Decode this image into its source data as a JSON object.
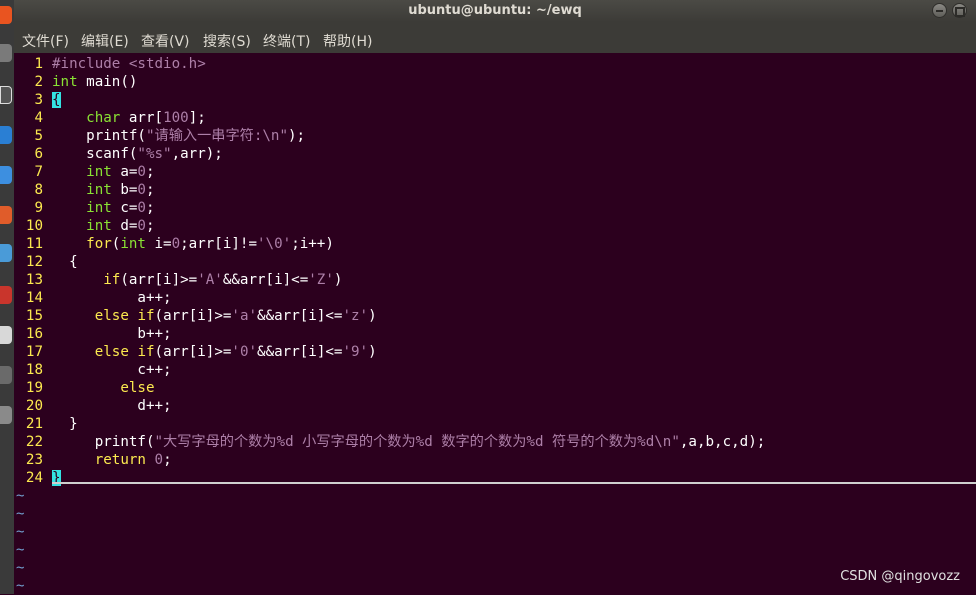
{
  "window": {
    "title": "ubuntu@ubuntu: ~/ewq"
  },
  "menubar": [
    "文件(F)",
    "编辑(E)",
    "查看(V)",
    "搜索(S)",
    "终端(T)",
    "帮助(H)"
  ],
  "editor": {
    "lines": [
      {
        "n": "1",
        "code": "#include <stdio.h>"
      },
      {
        "n": "2",
        "code": "int main()"
      },
      {
        "n": "3",
        "code": "{"
      },
      {
        "n": "4",
        "code": "    char arr[100];"
      },
      {
        "n": "5",
        "code": "    printf(\"请输入一串字符:\\n\");"
      },
      {
        "n": "6",
        "code": "    scanf(\"%s\",arr);"
      },
      {
        "n": "7",
        "code": "    int a=0;"
      },
      {
        "n": "8",
        "code": "    int b=0;"
      },
      {
        "n": "9",
        "code": "    int c=0;"
      },
      {
        "n": "10",
        "code": "    int d=0;"
      },
      {
        "n": "11",
        "code": "    for(int i=0;arr[i]!='\\0';i++)"
      },
      {
        "n": "12",
        "code": "  {"
      },
      {
        "n": "13",
        "code": "      if(arr[i]>='A'&&arr[i]<='Z')"
      },
      {
        "n": "14",
        "code": "          a++;"
      },
      {
        "n": "15",
        "code": "     else if(arr[i]>='a'&&arr[i]<='z')"
      },
      {
        "n": "16",
        "code": "          b++;"
      },
      {
        "n": "17",
        "code": "     else if(arr[i]>='0'&&arr[i]<='9')"
      },
      {
        "n": "18",
        "code": "          c++;"
      },
      {
        "n": "19",
        "code": "        else"
      },
      {
        "n": "20",
        "code": "          d++;"
      },
      {
        "n": "21",
        "code": "  }"
      },
      {
        "n": "22",
        "code": "     printf(\"大写字母的个数为%d 小写字母的个数为%d 数字的个数为%d 符号的个数为%d\\n\",a,b,c,d);"
      },
      {
        "n": "23",
        "code": "     return 0;"
      },
      {
        "n": "24",
        "code": "}"
      }
    ],
    "empty_line_marker": "~",
    "empty_line_count": 6
  },
  "watermark": "CSDN @qingovozz",
  "colors": {
    "background": "#2c001e",
    "line_numbers": "#fce94f",
    "types": "#8ae234",
    "strings_numbers": "#ad7fa8",
    "tilde": "#729fcf",
    "cursor": "#34e2e2"
  },
  "icons": [
    "minimize-icon",
    "maximize-icon",
    "close-icon"
  ]
}
